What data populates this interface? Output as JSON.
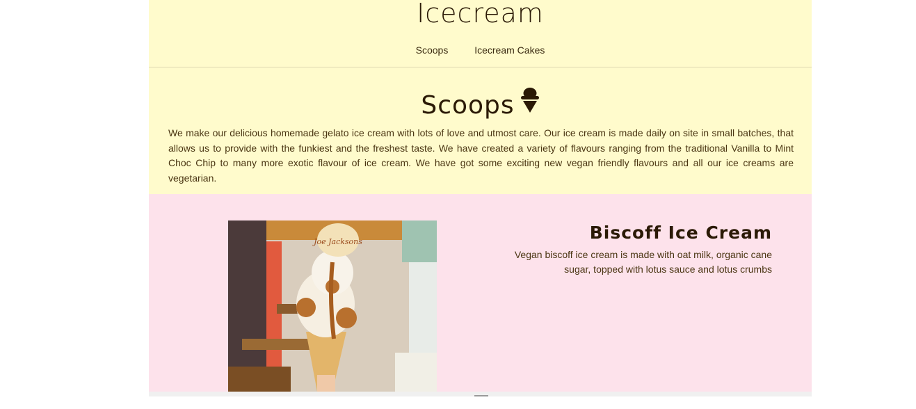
{
  "site": {
    "title": "Icecream"
  },
  "nav": {
    "items": [
      "Scoops",
      "Icecream Cakes"
    ]
  },
  "intro": {
    "title": "Scoops",
    "icon": "ice-cream-cone-icon",
    "text": "We make our delicious homemade gelato ice cream with lots of love and utmost care. Our ice cream is made daily on site in small batches, that allows us to provide with the funkiest and the freshest taste. We have created a variety of flavours ranging from the traditional Vanilla to Mint Choc Chip to many more exotic flavour of ice cream. We have got some exciting new vegan friendly flavours and all our ice creams are vegetarian."
  },
  "product": {
    "name": "Biscoff Ice Cream",
    "description": "Vegan biscoff ice cream is made with oat milk, organic cane sugar, topped with lotus sauce and lotus crumbs",
    "photo_text": "Joe Jacksons"
  },
  "colors": {
    "header_bg": "#fffbcc",
    "product_bg": "#fde2eb",
    "text_dark": "#2b1a06"
  }
}
